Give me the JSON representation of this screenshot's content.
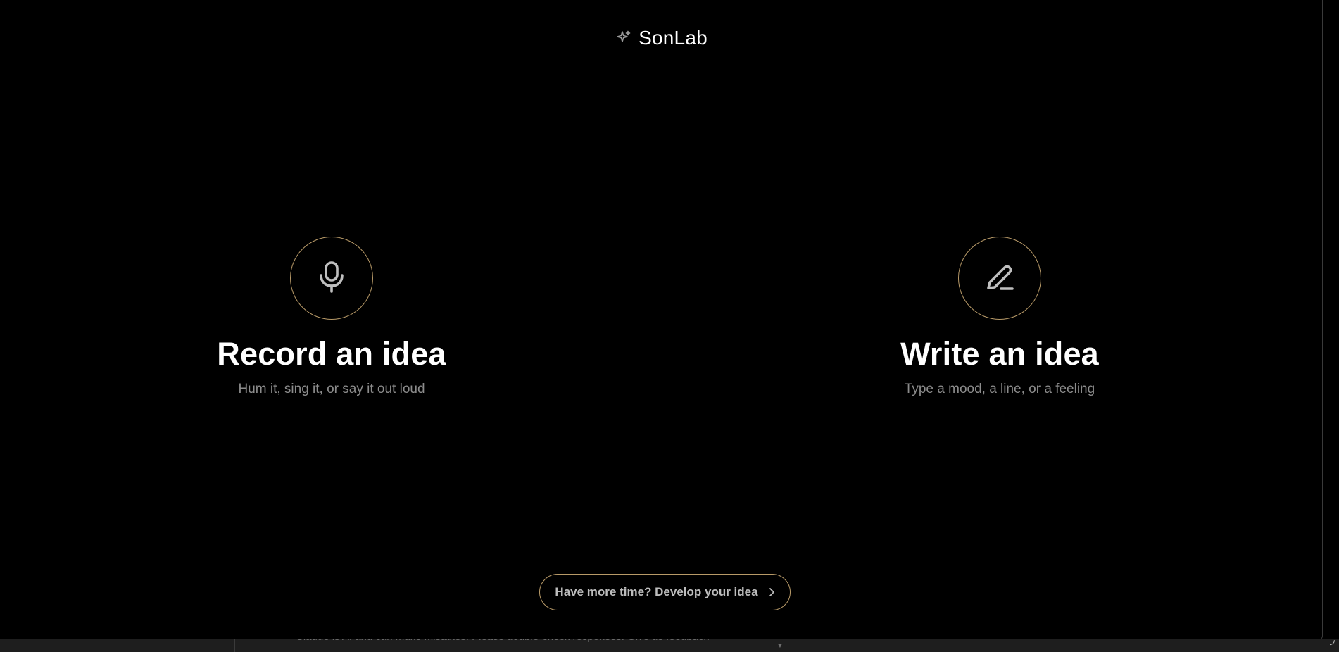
{
  "app": {
    "brand_name": "SonLab",
    "brand_icon": "sparkle-icon",
    "accent_color": "#b89a68"
  },
  "options": [
    {
      "icon": "microphone-icon",
      "title": "Record an idea",
      "subtitle": "Hum it, sing it, or say it out loud"
    },
    {
      "icon": "pencil-icon",
      "title": "Write an idea",
      "subtitle": "Type a mood, a line, or a feeling"
    }
  ],
  "develop": {
    "label": "Have more time? Develop your idea",
    "icon": "chevron-right-icon"
  },
  "background_page": {
    "disclaimer": "Claude is AI and can make mistakes. Please double-check responses.",
    "feedback_link": "Give us feedback"
  }
}
